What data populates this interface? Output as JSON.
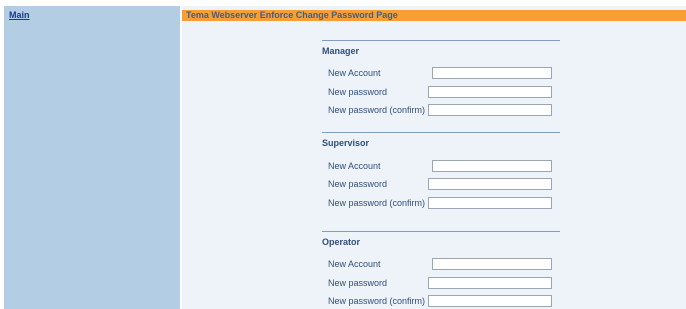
{
  "nav": {
    "main_link": "Main"
  },
  "page": {
    "title": "Tema Webserver Enforce Change Password Page"
  },
  "labels": {
    "new_account": "New Account",
    "new_password": "New password",
    "new_password_confirm": "New password (confirm)"
  },
  "sections": [
    {
      "heading": "Manager",
      "new_account": {
        "value": ""
      },
      "new_password": {
        "value": ""
      },
      "new_password_confirm": {
        "value": ""
      }
    },
    {
      "heading": "Supervisor",
      "new_account": {
        "value": ""
      },
      "new_password": {
        "value": ""
      },
      "new_password_confirm": {
        "value": ""
      }
    },
    {
      "heading": "Operator",
      "new_account": {
        "value": ""
      },
      "new_password": {
        "value": ""
      },
      "new_password_confirm": {
        "value": ""
      }
    }
  ]
}
